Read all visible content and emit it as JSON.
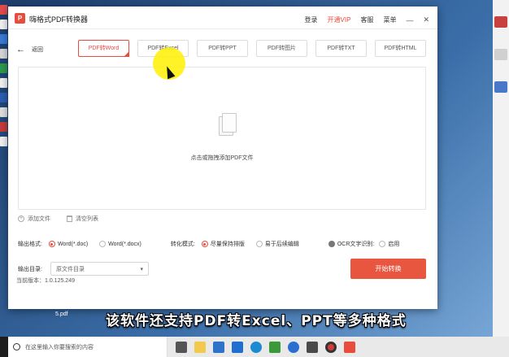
{
  "app": {
    "logo_glyph": "P",
    "title": "嗨格式PDF转换器",
    "menu": {
      "login": "登录",
      "vip": "开通VIP",
      "support": "客服",
      "menu": "菜单",
      "minimize": "—",
      "close": "✕"
    }
  },
  "back": {
    "arrow": "←",
    "label": "返回"
  },
  "tabs": [
    {
      "label": "PDF转Word",
      "active": true
    },
    {
      "label": "PDF转Excel",
      "active": false
    },
    {
      "label": "PDF转PPT",
      "active": false
    },
    {
      "label": "PDF转图片",
      "active": false
    },
    {
      "label": "PDF转TXT",
      "active": false
    },
    {
      "label": "PDF转HTML",
      "active": false
    }
  ],
  "dropzone": {
    "text": "点击或拖拽添加PDF文件"
  },
  "file_actions": {
    "add": "添加文件",
    "clear": "清空列表"
  },
  "options": {
    "format_label": "输出格式:",
    "format_doc": "Word(*.doc)",
    "format_docx": "Word(*.docx)",
    "mode_label": "转化模式:",
    "mode_keep": "尽量保持排版",
    "mode_edit": "易于后续编辑",
    "ocr_label": "OCR文字识别:",
    "ocr_state": "启用"
  },
  "output": {
    "label": "输出目录:",
    "value": "原文件目录",
    "caret": "▾"
  },
  "start_button": "开始转换",
  "version": "当前版本：1.0.125.249",
  "subtitle": "该软件还支持PDF转Excel、PPT等多种格式",
  "desktop_file": "5.pdf",
  "taskbar": {
    "search_placeholder": "在这里输入你要搜索的内容"
  },
  "colors": {
    "accent": "#e84c3d",
    "start_button": "#e8563f",
    "cursor_highlight": "#fff000"
  },
  "icons": [
    "back-arrow-icon",
    "document-icon",
    "add-icon",
    "trash-icon",
    "search-icon",
    "cursor-icon"
  ]
}
